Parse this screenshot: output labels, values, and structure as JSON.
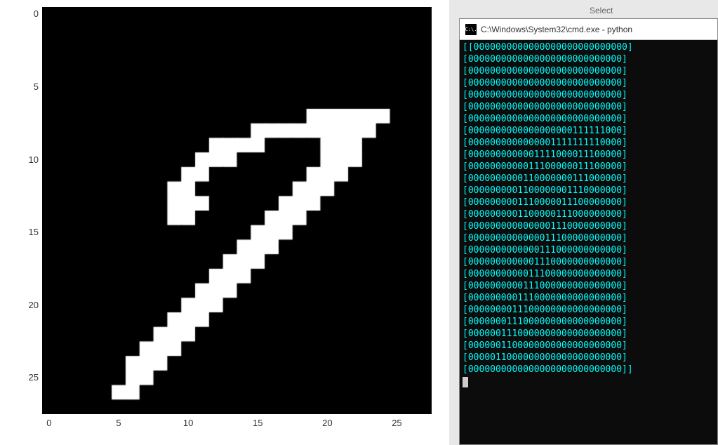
{
  "chart_data": {
    "type": "heatmap",
    "title": "",
    "xlabel": "",
    "ylabel": "",
    "x_ticks": [
      0,
      5,
      10,
      15,
      20,
      25
    ],
    "y_ticks": [
      0,
      5,
      10,
      15,
      20,
      25
    ],
    "xlim": [
      -0.5,
      27.5
    ],
    "ylim": [
      27.5,
      -0.5
    ],
    "matrix": [
      "0000000000000000000000000000",
      "0000000000000000000000000000",
      "0000000000000000000000000000",
      "0000000000000000000000000000",
      "0000000000000000000000000000",
      "0000000000000000000000000000",
      "0000000000000000000000000000",
      "0000000000000000000111111000",
      "0000000000000001111111110000",
      "0000000000001111000011100000",
      "0000000000011100000011100000",
      "0000000000110000000111000000",
      "0000000001100000001110000000",
      "0000000001110000011100000000",
      "0000000001100000111000000000",
      "0000000000000001110000000000",
      "0000000000000011100000000000",
      "0000000000000111000000000000",
      "0000000000001110000000000000",
      "0000000000011100000000000000",
      "0000000000111000000000000000",
      "0000000001110000000000000000",
      "0000000011100000000000000000",
      "0000000111000000000000000000",
      "0000001110000000000000000000",
      "0000001100000000000000000000",
      "0000011000000000000000000000",
      "0000000000000000000000000000"
    ]
  },
  "cmd": {
    "icon_label": "C:\\.",
    "title": "C:\\Windows\\System32\\cmd.exe - python",
    "select_label": "Select"
  }
}
